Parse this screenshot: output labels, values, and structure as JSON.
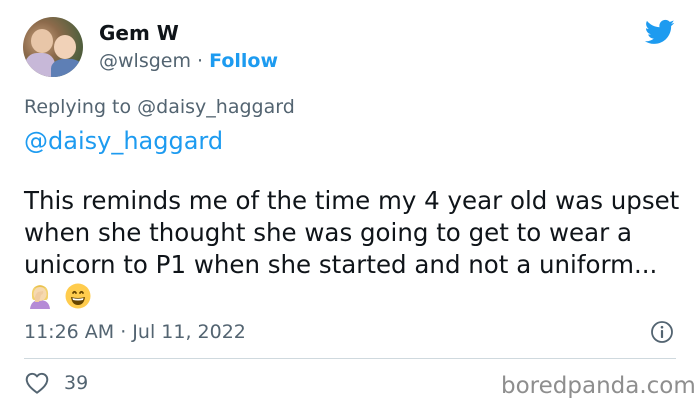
{
  "user": {
    "name": "Gem W",
    "handle": "@wlsgem",
    "separator": "·",
    "follow_label": "Follow"
  },
  "reply": {
    "replying_to": "Replying to @daisy_haggard",
    "mention": "@daisy_haggard"
  },
  "tweet": {
    "text": "This reminds me of the time my 4 year old was upset when she thought she was going to get to wear a unicorn to P1 when she started and not a uniform...",
    "emojis": [
      "woman-facepalming-icon",
      "grinning-face-icon"
    ],
    "timestamp": "11:26 AM · Jul 11, 2022"
  },
  "actions": {
    "like_count": "39"
  },
  "watermark": "boredpanda.com",
  "colors": {
    "accent": "#1d9bf0",
    "secondary_text": "#536471",
    "primary_text": "#0f1419",
    "divider": "#cfd9de"
  }
}
